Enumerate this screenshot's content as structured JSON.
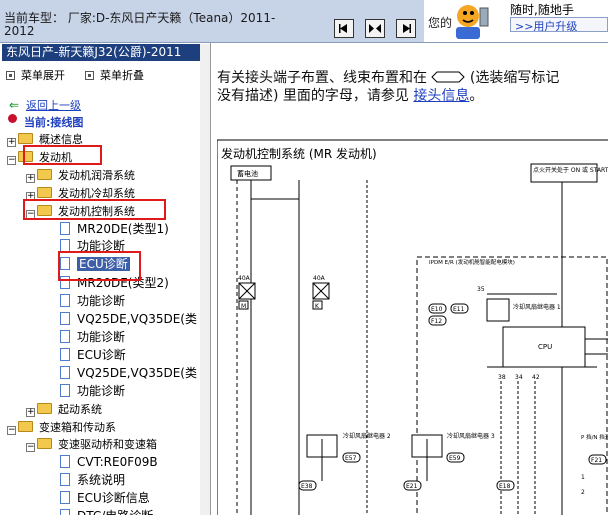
{
  "top": {
    "car_model": "当前车型： 厂家:D-东风日产天籁（Teana）2011-2012",
    "nav_buttons": [
      "back",
      "forward-first",
      "forward"
    ]
  },
  "ad": {
    "slogan": "您的",
    "line1": "随时,随地手",
    "link": ">>用户升级"
  },
  "left": {
    "title": "东风日产-新天籁J32(公爵)-2011",
    "expand_all": "菜单展开",
    "collapse_all": "菜单折叠",
    "back": "返回上一级",
    "current": "当前:接线图",
    "tree": [
      {
        "label": "概述信息",
        "type": "folder",
        "level": 1,
        "toggle": "+"
      },
      {
        "label": "发动机",
        "type": "folder",
        "level": 1,
        "toggle": "-"
      },
      {
        "label": "发动机润滑系统",
        "type": "folder",
        "level": 2,
        "toggle": "+"
      },
      {
        "label": "发动机冷却系统",
        "type": "folder",
        "level": 2,
        "toggle": "+"
      },
      {
        "label": "发动机控制系统",
        "type": "folder",
        "level": 2,
        "toggle": "-"
      },
      {
        "label": "MR20DE(类型1)",
        "type": "doc",
        "level": 3
      },
      {
        "label": "功能诊断",
        "type": "doc",
        "level": 3
      },
      {
        "label": "ECU诊断",
        "type": "doc",
        "level": 3,
        "selected": true
      },
      {
        "label": "MR20DE(类型2)",
        "type": "doc",
        "level": 3
      },
      {
        "label": "功能诊断",
        "type": "doc",
        "level": 3
      },
      {
        "label": "VQ25DE,VQ35DE(类",
        "type": "doc",
        "level": 3
      },
      {
        "label": "功能诊断",
        "type": "doc",
        "level": 3
      },
      {
        "label": "ECU诊断",
        "type": "doc",
        "level": 3
      },
      {
        "label": "VQ25DE,VQ35DE(类",
        "type": "doc",
        "level": 3
      },
      {
        "label": "功能诊断",
        "type": "doc",
        "level": 3
      },
      {
        "label": "起动系统",
        "type": "folder",
        "level": 2,
        "toggle": "+"
      },
      {
        "label": "变速箱和传动系",
        "type": "folder",
        "level": 1,
        "toggle": "-"
      },
      {
        "label": "变速驱动桥和变速箱",
        "type": "folder",
        "level": 2,
        "toggle": "-"
      },
      {
        "label": "CVT:RE0F09B",
        "type": "doc",
        "level": 3
      },
      {
        "label": "系统说明",
        "type": "doc",
        "level": 3
      },
      {
        "label": "ECU诊断信息",
        "type": "doc",
        "level": 3
      },
      {
        "label": "DTC/电路诊断",
        "type": "doc",
        "level": 3
      }
    ]
  },
  "content": {
    "info_prefix": "有关接头端子布置、线束布置和在",
    "info_mid": "(选装缩写标记",
    "info_line2": "没有描述) 里面的字母，请参见",
    "info_link": "接头信息",
    "info_end": "。",
    "diagram_title": "发动机控制系统 (MR 发动机)",
    "labels": {
      "battery": "蓄电池",
      "ign_switch": "点火开关处于 ON 或 START 位置",
      "ipdm": "IPDM E/R (发动机舱智能配电模块)",
      "e10": "E10",
      "e11": "E11",
      "f12": "F12",
      "fuse1": "40A",
      "fuse1_id": "M",
      "fuse2": "40A",
      "fuse2_id": "K",
      "relay1": "冷却风扇继电器 1",
      "relay2": "冷却风扇继电器 2",
      "relay3": "冷却风扇继电器 3",
      "cpu": "CPU",
      "pin35": "35",
      "pins": [
        "38",
        "34",
        "42"
      ],
      "e57": "E57",
      "e59": "E59",
      "e38": "E38",
      "e21": "E21",
      "e18": "E18",
      "pn_switch": "P 挡/N 挡开关",
      "f21": "F21",
      "pin1": "1",
      "pin2": "2"
    }
  },
  "colors": {
    "accent_blue": "#1d3f7e",
    "highlight_red": "#e01a1a",
    "link": "#1e3fbf"
  }
}
